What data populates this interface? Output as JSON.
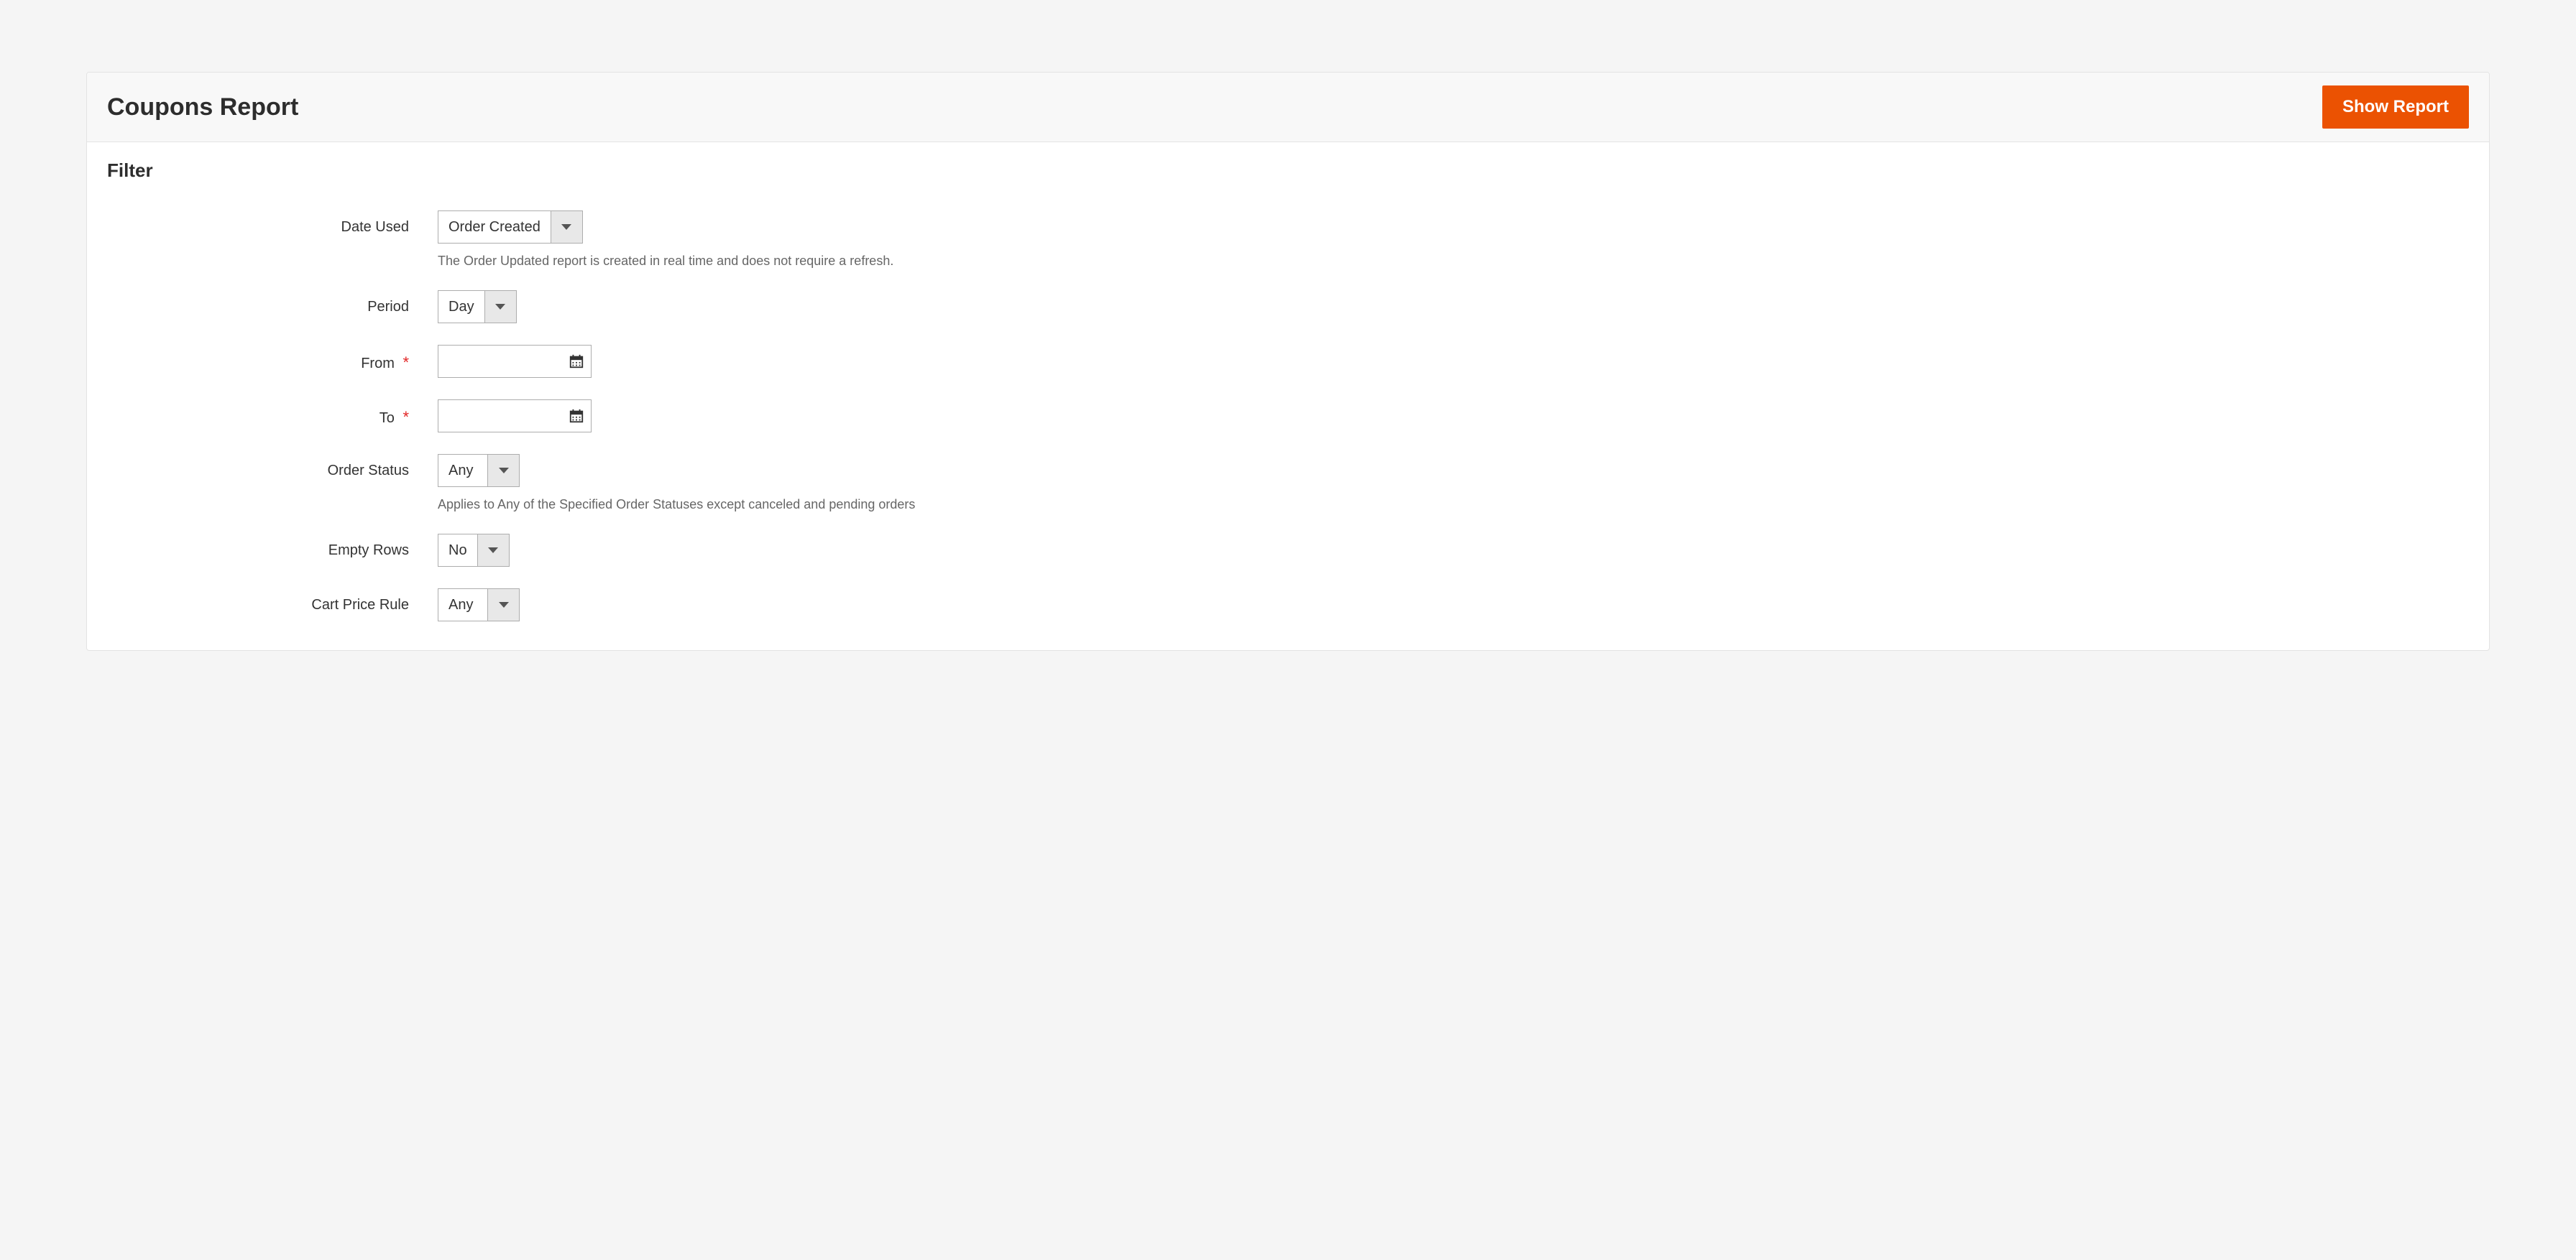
{
  "header": {
    "title": "Coupons Report",
    "show_report_button": "Show Report"
  },
  "filter_section": {
    "title": "Filter"
  },
  "fields": {
    "date_used": {
      "label": "Date Used",
      "value": "Order Created",
      "helper": "The Order Updated report is created in real time and does not require a refresh."
    },
    "period": {
      "label": "Period",
      "value": "Day"
    },
    "from": {
      "label": "From",
      "value": "",
      "required": true
    },
    "to": {
      "label": "To",
      "value": "",
      "required": true
    },
    "order_status": {
      "label": "Order Status",
      "value": "Any",
      "helper": "Applies to Any of the Specified Order Statuses except canceled and pending orders"
    },
    "empty_rows": {
      "label": "Empty Rows",
      "value": "No"
    },
    "cart_price_rule": {
      "label": "Cart Price Rule",
      "value": "Any"
    }
  }
}
